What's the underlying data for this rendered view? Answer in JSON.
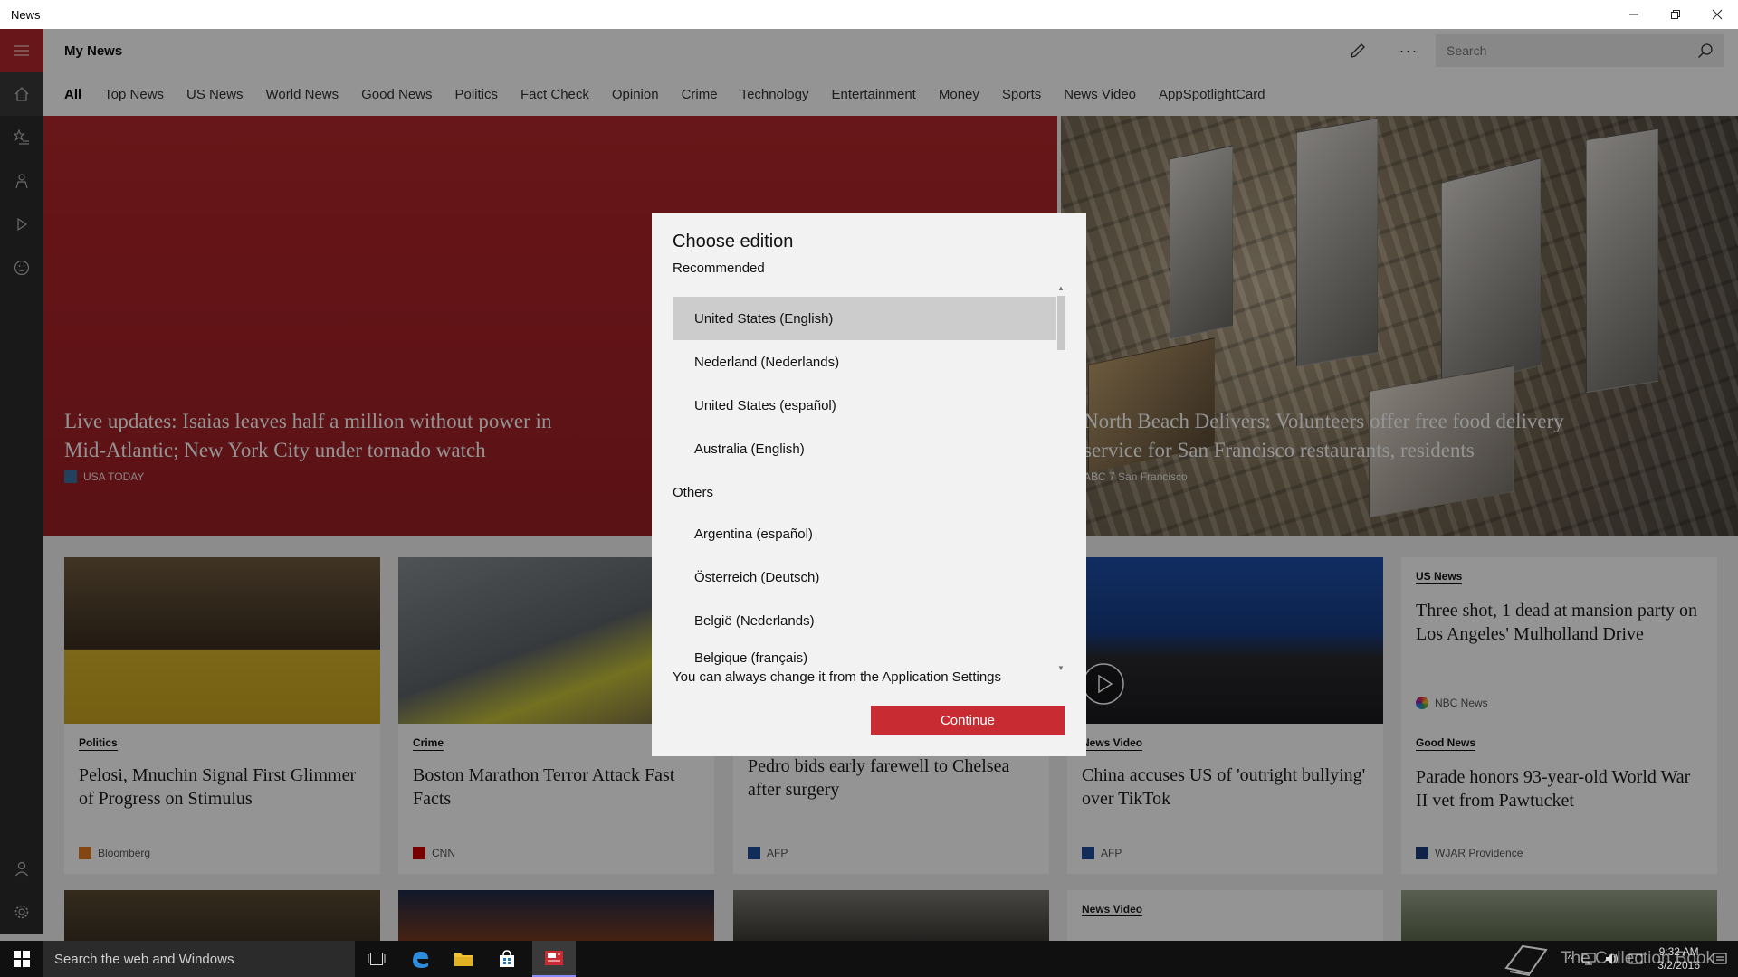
{
  "window": {
    "title": "News"
  },
  "header": {
    "page_title": "My News",
    "search_placeholder": "Search"
  },
  "tabs": [
    "All",
    "Top News",
    "US News",
    "World News",
    "Good News",
    "Politics",
    "Fact Check",
    "Opinion",
    "Crime",
    "Technology",
    "Entertainment",
    "Money",
    "Sports",
    "News Video",
    "AppSpotlightCard"
  ],
  "hero": [
    {
      "headline": "Live updates: Isaias leaves half a million without power in Mid-Atlantic; New York City under tornado watch",
      "source": "USA TODAY"
    },
    {
      "headline": "North Beach Delivers: Volunteers offer free food delivery service for San Francisco restaurants, residents",
      "source": "ABC 7 San Francisco"
    }
  ],
  "cards": [
    {
      "category": "Politics",
      "title": "Pelosi, Mnuchin Signal First Glimmer of Progress on Stimulus",
      "source": "Bloomberg"
    },
    {
      "category": "Crime",
      "title": "Boston Marathon Terror Attack Fast Facts",
      "source": "CNN"
    },
    {
      "category": "",
      "title": "Pedro bids early farewell to Chelsea after surgery",
      "source": "AFP"
    },
    {
      "category": "News Video",
      "title": "China accuses US of 'outright bullying' over TikTok",
      "source": "AFP"
    },
    {
      "category": "US News",
      "title": "Three shot, 1 dead at mansion party on Los Angeles' Mulholland Drive",
      "source": "NBC News"
    },
    {
      "category": "Good News",
      "title": "Parade honors 93-year-old World War II vet from Pawtucket",
      "source": "WJAR Providence"
    }
  ],
  "row2": {
    "category": "News Video"
  },
  "dialog": {
    "title": "Choose edition",
    "recommended_label": "Recommended",
    "recommended": [
      "United States (English)",
      "Nederland (Nederlands)",
      "United States (español)",
      "Australia (English)"
    ],
    "others_label": "Others",
    "others": [
      "Argentina (español)",
      "Österreich (Deutsch)",
      "België (Nederlands)",
      "Belgique (français)"
    ],
    "hint": "You can always change it from the Application Settings",
    "continue_label": "Continue",
    "selected": "United States (English)"
  },
  "taskbar": {
    "search_text": "Search the web and Windows",
    "watermark": "The Collection Book",
    "time": "9:32 AM",
    "date": "3/2/2016"
  },
  "colors": {
    "accent": "#c82b31",
    "rail": "#2b2b2b",
    "taskbar": "#101010"
  }
}
